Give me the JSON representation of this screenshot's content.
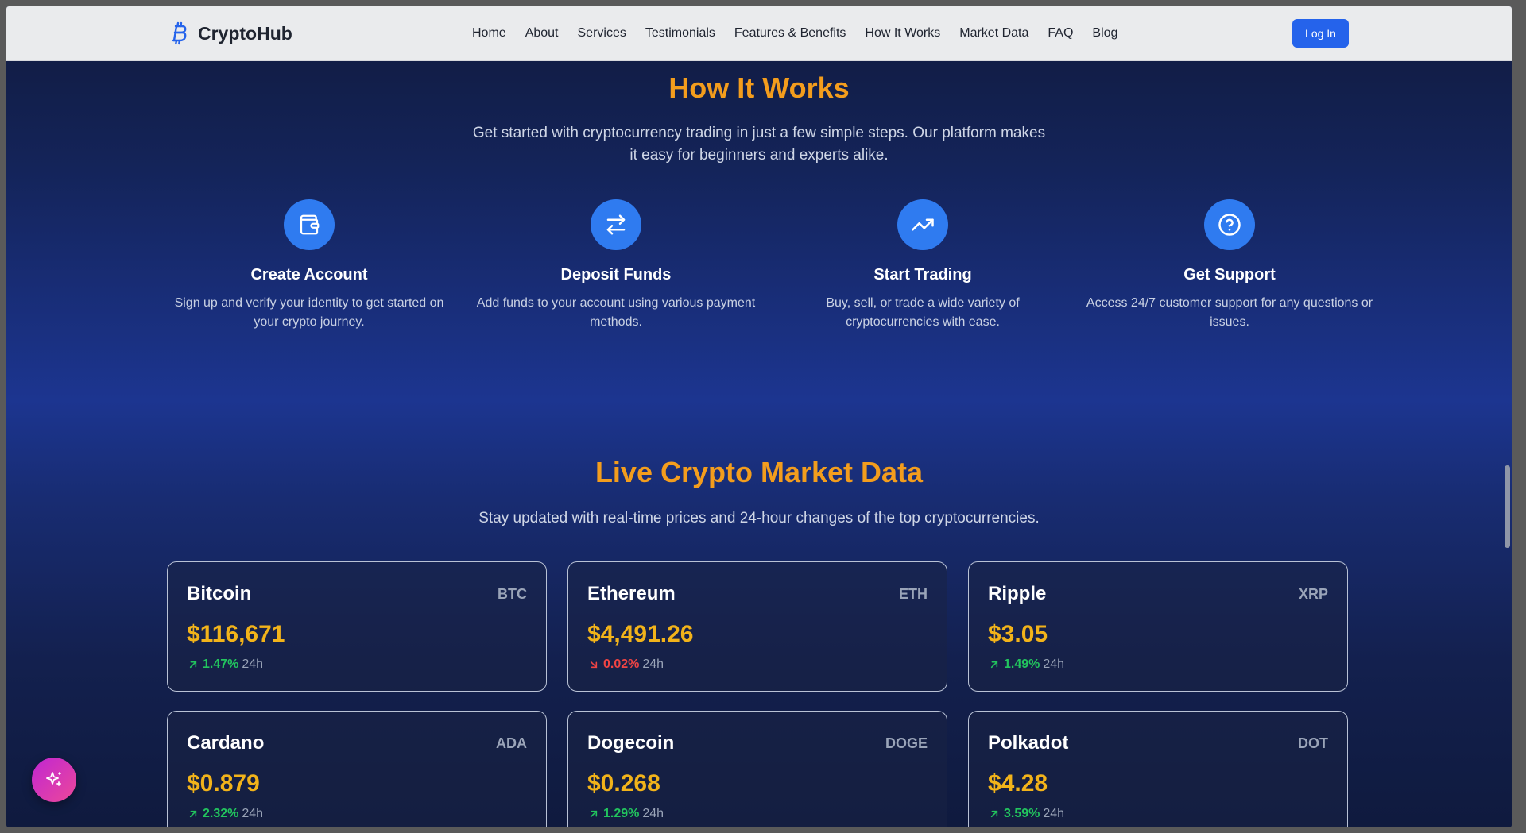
{
  "brand": {
    "name": "CryptoHub",
    "icon": "bitcoin-icon"
  },
  "nav": {
    "links": [
      "Home",
      "About",
      "Services",
      "Testimonials",
      "Features & Benefits",
      "How It Works",
      "Market Data",
      "FAQ",
      "Blog"
    ],
    "login_label": "Log In"
  },
  "how_it_works": {
    "title": "How It Works",
    "subtitle_line1": "Get started with cryptocurrency trading in just a few simple steps. Our platform makes",
    "subtitle_line2": "it easy for beginners and experts alike.",
    "steps": [
      {
        "icon": "wallet-icon",
        "title": "Create Account",
        "desc": "Sign up and verify your identity to get started on your crypto journey."
      },
      {
        "icon": "arrows-exchange-icon",
        "title": "Deposit Funds",
        "desc": "Add funds to your account using various payment methods."
      },
      {
        "icon": "trending-up-icon",
        "title": "Start Trading",
        "desc": "Buy, sell, or trade a wide variety of cryptocurrencies with ease."
      },
      {
        "icon": "help-circle-icon",
        "title": "Get Support",
        "desc": "Access 24/7 customer support for any questions or issues."
      }
    ]
  },
  "market": {
    "title": "Live Crypto Market Data",
    "subtitle": "Stay updated with real-time prices and 24-hour changes of the top cryptocurrencies.",
    "period_label": "24h",
    "coins": [
      {
        "name": "Bitcoin",
        "symbol": "BTC",
        "price": "$116,671",
        "change": "1.47%",
        "direction": "up"
      },
      {
        "name": "Ethereum",
        "symbol": "ETH",
        "price": "$4,491.26",
        "change": "0.02%",
        "direction": "down"
      },
      {
        "name": "Ripple",
        "symbol": "XRP",
        "price": "$3.05",
        "change": "1.49%",
        "direction": "up"
      },
      {
        "name": "Cardano",
        "symbol": "ADA",
        "price": "$0.879",
        "change": "2.32%",
        "direction": "up"
      },
      {
        "name": "Dogecoin",
        "symbol": "DOGE",
        "price": "$0.268",
        "change": "1.29%",
        "direction": "up"
      },
      {
        "name": "Polkadot",
        "symbol": "DOT",
        "price": "$4.28",
        "change": "3.59%",
        "direction": "up"
      }
    ]
  },
  "fab": {
    "icon": "sparkles-icon"
  },
  "colors": {
    "accent": "#f39d1d",
    "primary": "#2563eb",
    "price": "#f2b31a",
    "up": "#22c55e",
    "down": "#ef4444"
  }
}
